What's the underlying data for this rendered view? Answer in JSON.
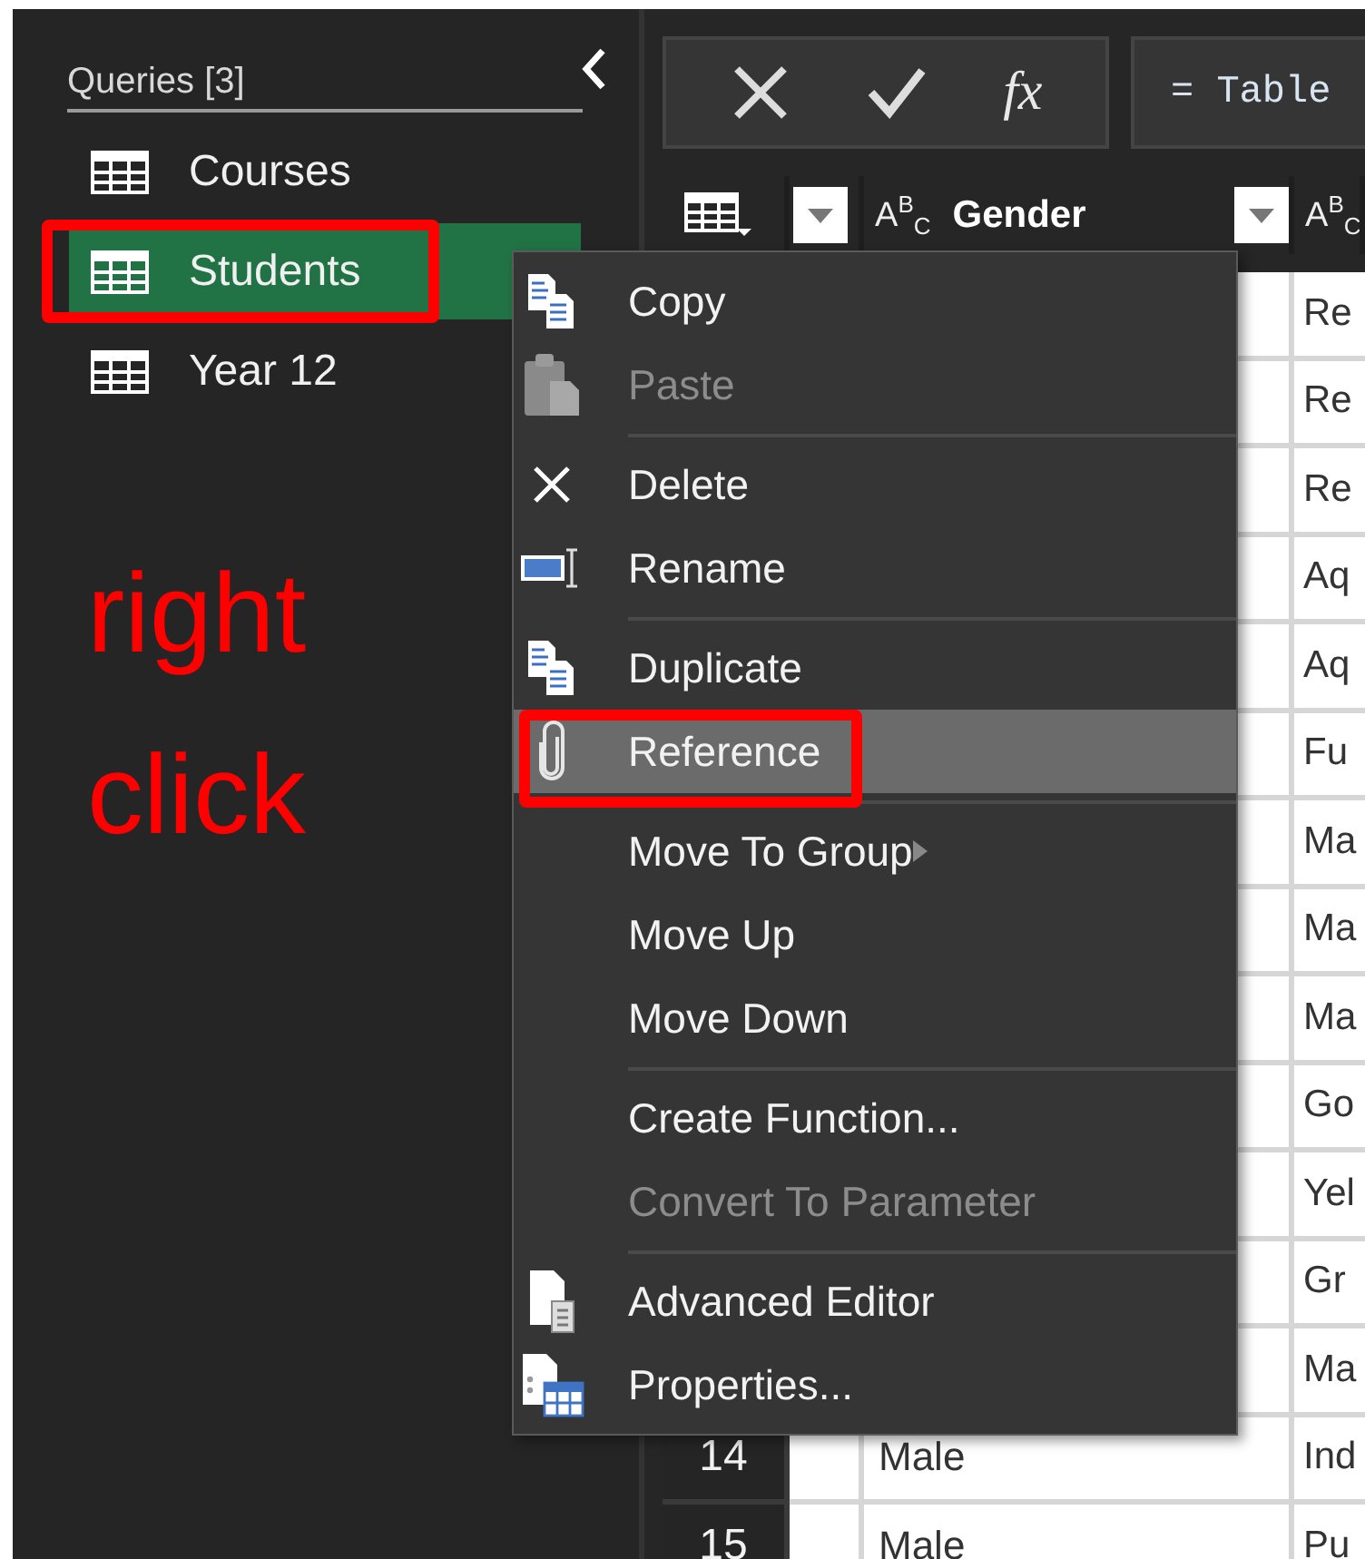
{
  "queries": {
    "title": "Queries [3]",
    "items": [
      {
        "name": "Courses",
        "selected": false,
        "annotated": false
      },
      {
        "name": "Students",
        "selected": true,
        "annotated": true
      },
      {
        "name": "Year 12",
        "selected": false,
        "annotated": false
      }
    ]
  },
  "annotation": {
    "lines": [
      "right",
      "click"
    ]
  },
  "formula_bar": {
    "function_label": "fx",
    "formula": "= Table"
  },
  "table": {
    "columns": [
      {
        "type": "A$^{B}$$_{C}$",
        "name": "Gender"
      },
      {
        "type": "A$^{B}$$_{C}$"
      }
    ],
    "rows": [
      {
        "column_4": "Re"
      },
      {
        "column_4": "Re"
      },
      {
        "column_4": "Re"
      },
      {
        "column_4": "Aq"
      },
      {
        "column_4": "Aq"
      },
      {
        "column_4": "Fu"
      },
      {
        "column_4": "Ma"
      },
      {
        "column_4": "Ma"
      },
      {
        "column_4": "Ma"
      },
      {
        "column_4": "Go"
      },
      {
        "column_4": "Yel"
      },
      {
        "column_4": "Gr"
      },
      {
        "column_4": "Ma"
      },
      {
        "number": "14",
        "gender": "Male",
        "column_4": "Ind"
      },
      {
        "number": "15",
        "gender": "Male",
        "column_4": "Pu"
      }
    ]
  },
  "context_menu": {
    "groups": [
      [
        {
          "label": "Copy",
          "disabled": false,
          "selected": false,
          "submenu": false,
          "annotated": false
        },
        {
          "label": "Paste",
          "disabled": true,
          "selected": false,
          "submenu": false,
          "annotated": false
        }
      ],
      [
        {
          "label": "Delete",
          "disabled": false,
          "selected": false,
          "submenu": false,
          "annotated": false
        },
        {
          "label": "Rename",
          "disabled": false,
          "selected": false,
          "submenu": false,
          "annotated": false
        }
      ],
      [
        {
          "label": "Duplicate",
          "disabled": false,
          "selected": false,
          "submenu": false,
          "annotated": false
        },
        {
          "label": "Reference",
          "disabled": false,
          "selected": true,
          "submenu": false,
          "annotated": true
        }
      ],
      [
        {
          "label": "Move To Group",
          "disabled": false,
          "selected": false,
          "submenu": true,
          "annotated": false
        },
        {
          "label": "Move Up",
          "disabled": false,
          "selected": false,
          "submenu": false,
          "annotated": false
        },
        {
          "label": "Move Down",
          "disabled": false,
          "selected": false,
          "submenu": false,
          "annotated": false
        }
      ],
      [
        {
          "label": "Create Function...",
          "disabled": false,
          "selected": false,
          "submenu": false,
          "annotated": false
        },
        {
          "label": "Convert To Parameter",
          "disabled": true,
          "selected": false,
          "submenu": false,
          "annotated": false
        }
      ],
      [
        {
          "label": "Advanced Editor",
          "disabled": false,
          "selected": false,
          "submenu": false,
          "annotated": false
        },
        {
          "label": "Properties...",
          "disabled": false,
          "selected": false,
          "submenu": false,
          "annotated": false
        }
      ]
    ]
  }
}
